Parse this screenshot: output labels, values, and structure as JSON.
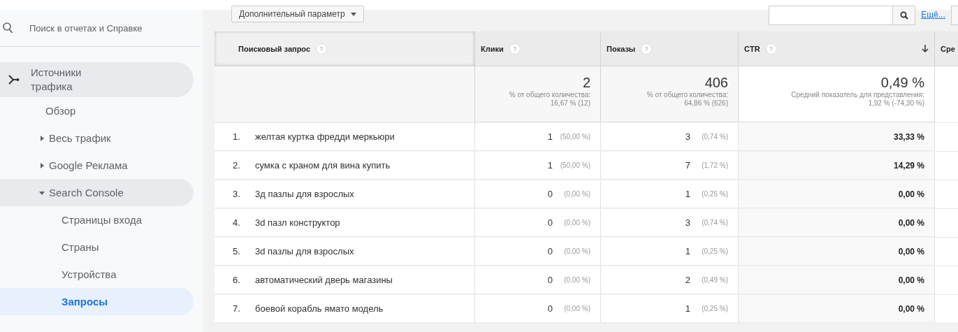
{
  "sidebar": {
    "search": {
      "placeholder": "Поиск в отчетах и Справке"
    },
    "nav": [
      {
        "label": "Источники трафика",
        "kind": "section",
        "expanded": true,
        "selected": false,
        "children": [
          {
            "label": "Обзор",
            "kind": "link",
            "selected": false
          },
          {
            "label": "Весь трафик",
            "kind": "group",
            "expanded": false,
            "selected": false
          },
          {
            "label": "Google Реклама",
            "kind": "group",
            "expanded": false,
            "selected": false
          },
          {
            "label": "Search Console",
            "kind": "group",
            "expanded": true,
            "selected": false,
            "children": [
              {
                "label": "Страницы входа",
                "kind": "link",
                "selected": false
              },
              {
                "label": "Страны",
                "kind": "link",
                "selected": false
              },
              {
                "label": "Устройства",
                "kind": "link",
                "selected": false
              },
              {
                "label": "Запросы",
                "kind": "link",
                "selected": true
              }
            ]
          }
        ]
      }
    ]
  },
  "toolbar": {
    "dimension_dropdown": "Дополнительный параметр",
    "more_link": "Ещё..."
  },
  "table": {
    "columns": [
      {
        "label": "Поисковый запрос",
        "help": "?",
        "sorted": false,
        "primary": true
      },
      {
        "label": "Клики",
        "help": "?",
        "sorted": false,
        "primary": false
      },
      {
        "label": "Показы",
        "help": "?",
        "sorted": false,
        "primary": false
      },
      {
        "label": "CTR",
        "help": "?",
        "sorted": true,
        "primary": false
      },
      {
        "label": "Сре",
        "primary": false
      }
    ],
    "summary": [
      {
        "value": "2",
        "note": "% от общего количества:",
        "detail": "16,67 % (12)"
      },
      {
        "value": "406",
        "note": "% от общего количества:",
        "detail": "64,86 % (626)"
      },
      {
        "value": "0,49 %",
        "note": "Средний показатель для представления:",
        "detail": "1,92 % (-74,30 %)"
      }
    ],
    "rows": [
      {
        "index": "1.",
        "query": "желтая куртка фредди меркьюри",
        "clicks": "1",
        "clicks_share": "(50,00 %)",
        "impressions": "3",
        "impressions_share": "(0,74 %)",
        "ctr": "33,33 %"
      },
      {
        "index": "2.",
        "query": "сумка с краном для вина купить",
        "clicks": "1",
        "clicks_share": "(50,00 %)",
        "impressions": "7",
        "impressions_share": "(1,72 %)",
        "ctr": "14,29 %"
      },
      {
        "index": "3.",
        "query": "3д пазлы для взрослых",
        "clicks": "0",
        "clicks_share": "(0,00 %)",
        "impressions": "1",
        "impressions_share": "(0,25 %)",
        "ctr": "0,00 %"
      },
      {
        "index": "4.",
        "query": "3d пазл конструктор",
        "clicks": "0",
        "clicks_share": "(0,00 %)",
        "impressions": "3",
        "impressions_share": "(0,74 %)",
        "ctr": "0,00 %"
      },
      {
        "index": "5.",
        "query": "3d пазлы для взрослых",
        "clicks": "0",
        "clicks_share": "(0,00 %)",
        "impressions": "1",
        "impressions_share": "(0,25 %)",
        "ctr": "0,00 %"
      },
      {
        "index": "6.",
        "query": "автоматический дверь магазины",
        "clicks": "0",
        "clicks_share": "(0,00 %)",
        "impressions": "2",
        "impressions_share": "(0,49 %)",
        "ctr": "0,00 %"
      },
      {
        "index": "7.",
        "query": "боевой корабль ямато модель",
        "clicks": "0",
        "clicks_share": "(0,00 %)",
        "impressions": "1",
        "impressions_share": "(0,25 %)",
        "ctr": "0,00 %"
      }
    ]
  }
}
